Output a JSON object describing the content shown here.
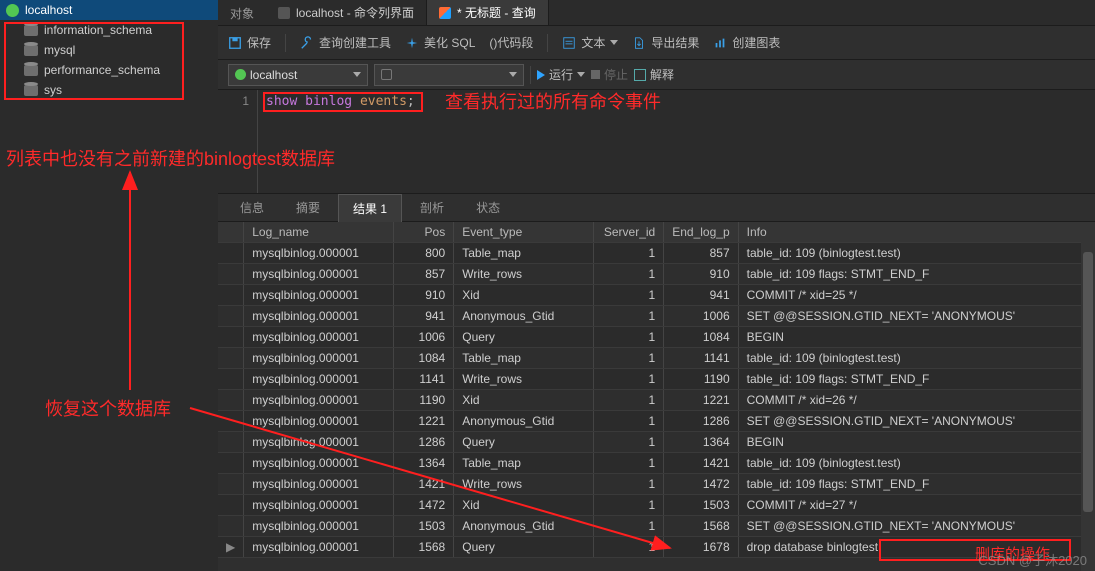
{
  "sidebar": {
    "connection": "localhost",
    "databases": [
      "information_schema",
      "mysql",
      "performance_schema",
      "sys"
    ]
  },
  "tabs": {
    "label_objects": "对象",
    "cli_tab": "localhost - 命令列界面",
    "query_tab": "* 无标题 - 查询"
  },
  "toolbar": {
    "save": "保存",
    "query_builder": "查询创建工具",
    "beautify": "美化 SQL",
    "snippet": "()代码段",
    "text": "文本",
    "export": "导出结果",
    "chart": "创建图表"
  },
  "runbar": {
    "connection": "localhost",
    "run": "运行",
    "stop": "停止",
    "explain": "解释"
  },
  "editor": {
    "line_number": "1",
    "code_tokens": {
      "kw1": "show",
      "kw2": "binlog",
      "id": "events",
      "punct": ";"
    }
  },
  "result_tabs": [
    "信息",
    "摘要",
    "结果 1",
    "剖析",
    "状态"
  ],
  "grid": {
    "headers": [
      "Log_name",
      "Pos",
      "Event_type",
      "Server_id",
      "End_log_p",
      "Info"
    ],
    "rows": [
      {
        "log": "mysqlbinlog.000001",
        "pos": 800,
        "type": "Table_map",
        "sid": 1,
        "elp": 857,
        "info": "table_id: 109 (binlogtest.test)"
      },
      {
        "log": "mysqlbinlog.000001",
        "pos": 857,
        "type": "Write_rows",
        "sid": 1,
        "elp": 910,
        "info": "table_id: 109 flags: STMT_END_F"
      },
      {
        "log": "mysqlbinlog.000001",
        "pos": 910,
        "type": "Xid",
        "sid": 1,
        "elp": 941,
        "info": "COMMIT /* xid=25 */"
      },
      {
        "log": "mysqlbinlog.000001",
        "pos": 941,
        "type": "Anonymous_Gtid",
        "sid": 1,
        "elp": 1006,
        "info": "SET @@SESSION.GTID_NEXT= 'ANONYMOUS'"
      },
      {
        "log": "mysqlbinlog.000001",
        "pos": 1006,
        "type": "Query",
        "sid": 1,
        "elp": 1084,
        "info": "BEGIN"
      },
      {
        "log": "mysqlbinlog.000001",
        "pos": 1084,
        "type": "Table_map",
        "sid": 1,
        "elp": 1141,
        "info": "table_id: 109 (binlogtest.test)"
      },
      {
        "log": "mysqlbinlog.000001",
        "pos": 1141,
        "type": "Write_rows",
        "sid": 1,
        "elp": 1190,
        "info": "table_id: 109 flags: STMT_END_F"
      },
      {
        "log": "mysqlbinlog.000001",
        "pos": 1190,
        "type": "Xid",
        "sid": 1,
        "elp": 1221,
        "info": "COMMIT /* xid=26 */"
      },
      {
        "log": "mysqlbinlog.000001",
        "pos": 1221,
        "type": "Anonymous_Gtid",
        "sid": 1,
        "elp": 1286,
        "info": "SET @@SESSION.GTID_NEXT= 'ANONYMOUS'"
      },
      {
        "log": "mysqlbinlog.000001",
        "pos": 1286,
        "type": "Query",
        "sid": 1,
        "elp": 1364,
        "info": "BEGIN"
      },
      {
        "log": "mysqlbinlog.000001",
        "pos": 1364,
        "type": "Table_map",
        "sid": 1,
        "elp": 1421,
        "info": "table_id: 109 (binlogtest.test)"
      },
      {
        "log": "mysqlbinlog.000001",
        "pos": 1421,
        "type": "Write_rows",
        "sid": 1,
        "elp": 1472,
        "info": "table_id: 109 flags: STMT_END_F"
      },
      {
        "log": "mysqlbinlog.000001",
        "pos": 1472,
        "type": "Xid",
        "sid": 1,
        "elp": 1503,
        "info": "COMMIT /* xid=27 */"
      },
      {
        "log": "mysqlbinlog.000001",
        "pos": 1503,
        "type": "Anonymous_Gtid",
        "sid": 1,
        "elp": 1568,
        "info": "SET @@SESSION.GTID_NEXT= 'ANONYMOUS'"
      },
      {
        "log": "mysqlbinlog.000001",
        "pos": 1568,
        "type": "Query",
        "sid": 1,
        "elp": 1678,
        "info": "drop database binlogtest"
      }
    ]
  },
  "annotations": {
    "sql_note": "查看执行过的所有命令事件",
    "db_note": "列表中也没有之前新建的binlogtest数据库",
    "restore_note": "恢复这个数据库",
    "drop_note": "删库的操作"
  },
  "watermark": "CSDN @子沐2020"
}
